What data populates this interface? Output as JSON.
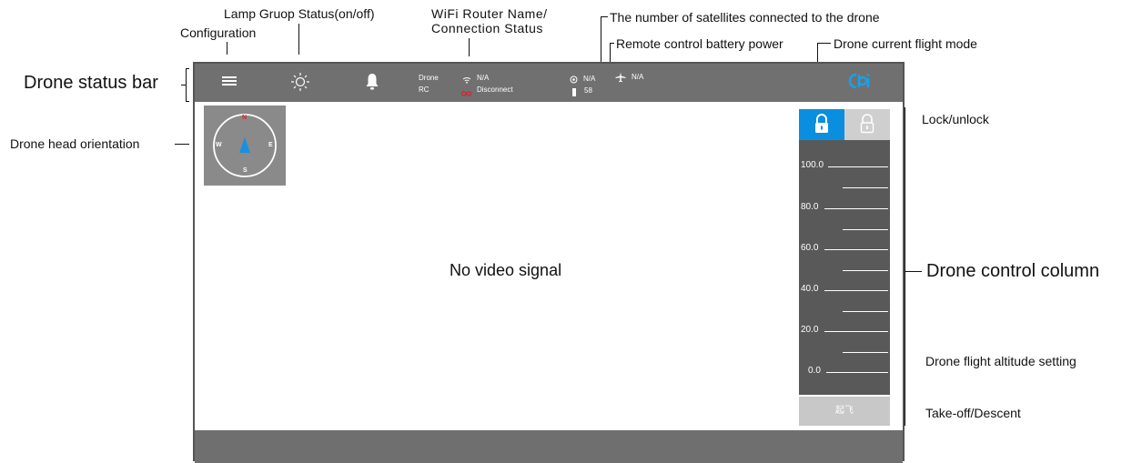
{
  "annotations": {
    "configuration": "Configuration",
    "lamp_group": "Lamp Gruop Status(on/off)",
    "wifi_line1": "WiFi Router Name/",
    "wifi_line2": "Connection Status",
    "satellites": "The number of satellites connected to the drone",
    "rc_battery": "Remote control battery power",
    "flight_mode": "Drone current flight mode",
    "status_bar": "Drone status bar",
    "head_orientation": "Drone head orientation",
    "lock_unlock": "Lock/unlock",
    "control_column": "Drone control column",
    "altitude_setting": "Drone flight altitude setting",
    "takeoff_descent": "Take-off/Descent"
  },
  "statusbar": {
    "drone_label": "Drone",
    "rc_label": "RC",
    "drone_wifi_value": "N/A",
    "rc_conn_value": "Disconnect",
    "satellites_value": "N/A",
    "battery_value": "58",
    "flight_mode_value": "N/A",
    "logo_text": "Obi"
  },
  "main": {
    "video_message": "No video signal"
  },
  "compass": {
    "north": "N",
    "south": "S",
    "east": "E",
    "west": "W"
  },
  "control": {
    "altitude_ticks": [
      "100.0",
      "80.0",
      "60.0",
      "40.0",
      "20.0",
      "0.0"
    ],
    "takeoff_label": "起飞"
  },
  "colors": {
    "statusbar_bg": "#707070",
    "lock_active": "#0a8fe0",
    "lock_inactive": "#cfcfcf",
    "altitude_bg": "#595959",
    "disconnect_red": "#e0202a",
    "compass_arrow": "#1a8fe0",
    "logo_blue": "#19a0e8"
  }
}
